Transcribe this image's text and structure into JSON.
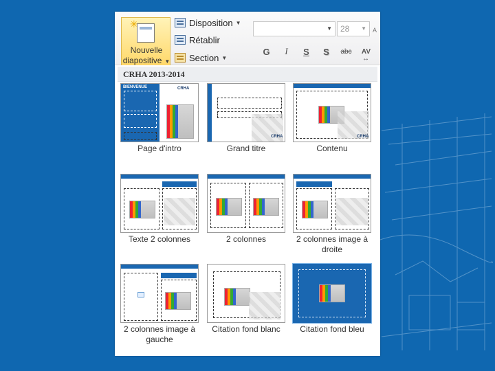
{
  "ribbon": {
    "new_slide_label_1": "Nouvelle",
    "new_slide_label_2": "diapositive",
    "disposition": "Disposition",
    "retablir": "Rétablir",
    "section": "Section",
    "font_size": "28",
    "bold": "G",
    "italic": "I",
    "underline": "S",
    "shadow": "S",
    "strike": "abc",
    "spacing": "AV"
  },
  "gallery": {
    "title": "CRHA 2013-2014",
    "layouts": [
      {
        "caption": "Page d'intro"
      },
      {
        "caption": "Grand titre"
      },
      {
        "caption": "Contenu"
      },
      {
        "caption": "Texte 2 colonnes"
      },
      {
        "caption": "2 colonnes"
      },
      {
        "caption": "2 colonnes image à droite"
      },
      {
        "caption": "2 colonnes image à gauche"
      },
      {
        "caption": "Citation fond blanc"
      },
      {
        "caption": "Citation fond bleu"
      }
    ],
    "intro_badge": "BIENVENUE",
    "logo_text": "CRHA",
    "selected": "Citation fond bleu"
  },
  "colors": {
    "background": "#0f67b0",
    "accent_blue": "#1a67b1",
    "new_slide_highlight": "#ffd86a"
  },
  "icons": {
    "new_slide": "new-slide-icon",
    "disposition": "layout-icon",
    "retablir": "reset-icon",
    "section": "section-icon"
  }
}
